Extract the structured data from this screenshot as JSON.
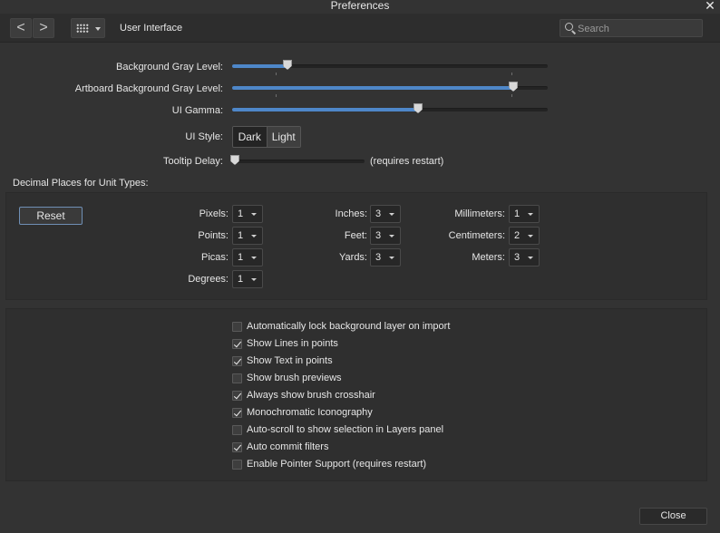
{
  "window": {
    "title": "Preferences",
    "close_glyph": "✕"
  },
  "toolbar": {
    "back_glyph": "<",
    "forward_glyph": ">",
    "section_title": "User Interface",
    "search_placeholder": "Search"
  },
  "sliders": [
    {
      "label": "Background Gray Level:",
      "value": 0.175
    },
    {
      "label": "Artboard Background Gray Level:",
      "value": 0.89
    },
    {
      "label": "UI Gamma:",
      "value": 0.59
    }
  ],
  "ui_style": {
    "label": "UI Style:",
    "options": [
      "Dark",
      "Light"
    ],
    "selected": "Dark"
  },
  "tooltip": {
    "label": "Tooltip Delay:",
    "value": 0.02,
    "note": "(requires restart)"
  },
  "decimal_places": {
    "title": "Decimal Places for Unit Types:",
    "reset_label": "Reset",
    "units": [
      {
        "label": "Pixels:",
        "value": "1"
      },
      {
        "label": "Points:",
        "value": "1"
      },
      {
        "label": "Picas:",
        "value": "1"
      },
      {
        "label": "Degrees:",
        "value": "1"
      },
      {
        "label": "Inches:",
        "value": "3"
      },
      {
        "label": "Feet:",
        "value": "3"
      },
      {
        "label": "Yards:",
        "value": "3"
      },
      {
        "label": "Millimeters:",
        "value": "1"
      },
      {
        "label": "Centimeters:",
        "value": "2"
      },
      {
        "label": "Meters:",
        "value": "3"
      }
    ]
  },
  "options": [
    {
      "label": "Automatically lock background layer on import",
      "checked": false
    },
    {
      "label": "Show Lines in points",
      "checked": true
    },
    {
      "label": "Show Text in points",
      "checked": true
    },
    {
      "label": "Show brush previews",
      "checked": false
    },
    {
      "label": "Always show brush crosshair",
      "checked": true
    },
    {
      "label": "Monochromatic Iconography",
      "checked": true
    },
    {
      "label": "Auto-scroll to show selection in Layers panel",
      "checked": false
    },
    {
      "label": "Auto commit filters",
      "checked": true
    },
    {
      "label": "Enable Pointer Support (requires restart)",
      "checked": false
    }
  ],
  "footer": {
    "close_label": "Close"
  },
  "colors": {
    "accent": "#4e87c9",
    "background": "#333333",
    "panel": "#2f2f2f"
  }
}
